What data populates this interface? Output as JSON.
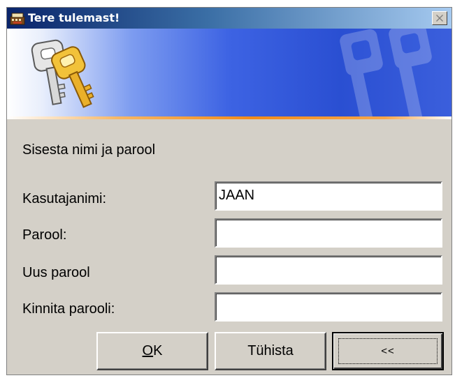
{
  "window": {
    "title": "Tere tulemast!"
  },
  "banner": {
    "icon": "keys-icon",
    "watermark_icon": "keys-watermark-icon",
    "accent_color": "#f28c1a",
    "gradient_color": "#2a4fd2"
  },
  "form": {
    "prompt": "Sisesta nimi ja parool",
    "username_label": "Kasutajanimi:",
    "username_value": "JAAN",
    "password_label": "Parool:",
    "password_value": "",
    "new_password_label": "Uus parool",
    "new_password_value": "",
    "confirm_password_label": "Kinnita parooli:",
    "confirm_password_value": ""
  },
  "buttons": {
    "ok_label": "OK",
    "cancel_label": "Tühista",
    "collapse_label": "<<"
  }
}
